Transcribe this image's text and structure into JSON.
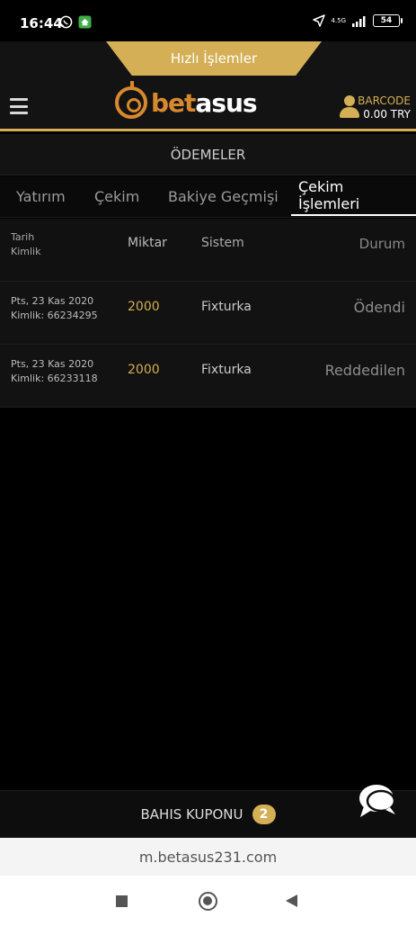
{
  "status_bar": {
    "time": "16:44",
    "network": "4.5G",
    "battery": "54"
  },
  "header": {
    "quick_actions": "Hızlı İşlemler",
    "logo_part1": "bet",
    "logo_part2": "asus",
    "account_name": "BARCODE",
    "balance": "0.00 TRY"
  },
  "page_title": "ÖDEMELER",
  "tabs": [
    {
      "label": "Yatırım",
      "active": false
    },
    {
      "label": "Çekim",
      "active": false
    },
    {
      "label": "Bakiye Geçmişi",
      "active": false
    },
    {
      "label": "Çekim İşlemleri",
      "active": true
    }
  ],
  "table": {
    "headers": {
      "date": "Tarih",
      "id": "Kimlik",
      "amount": "Miktar",
      "system": "Sistem",
      "status": "Durum"
    },
    "rows": [
      {
        "date": "Pts, 23 Kas 2020",
        "id": "Kimlik: 66234295",
        "amount": "2000",
        "system": "Fixturka",
        "status": "Ödendi"
      },
      {
        "date": "Pts, 23 Kas 2020",
        "id": "Kimlik: 66233118",
        "amount": "2000",
        "system": "Fixturka",
        "status": "Reddedilen"
      }
    ]
  },
  "coupon": {
    "label": "BAHIS KUPONU",
    "count": "2"
  },
  "browser": {
    "url": "m.betasus231.com"
  },
  "colors": {
    "accent": "#d4af55",
    "logo_orange": "#d8892d",
    "background": "#000000"
  }
}
